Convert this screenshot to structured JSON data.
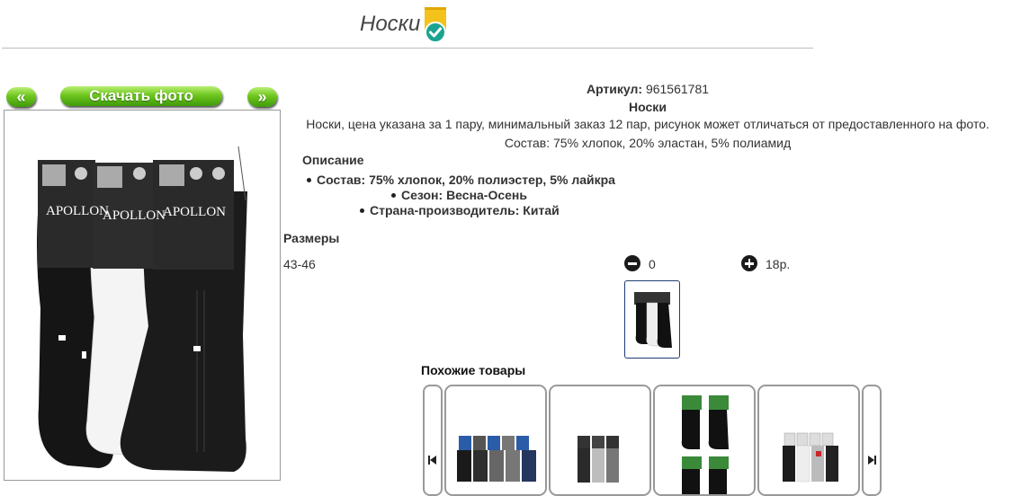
{
  "header": {
    "title": "Носки"
  },
  "photo_controls": {
    "prev_label": "«",
    "download_label": "Скачать фото",
    "next_label": "»"
  },
  "product": {
    "article_label": "Артикул:",
    "article_value": "961561781",
    "name": "Носки",
    "summary": "Носки, цена указана за 1 пару, минимальный заказ 12 пар, рисунок может отличаться от предоставленного на фото.",
    "composition": "Состав: 75% хлопок, 20% эластан, 5% полиамид",
    "description_heading": "Описание",
    "specs": [
      "Состав: 75% хлопок, 20% полиэстер, 5% лайкра",
      "Сезон: Весна-Осень",
      "Страна-производитель: Китай"
    ],
    "brand_label": "APOLLON"
  },
  "sizes": {
    "heading": "Размеры",
    "rows": [
      {
        "size": "43-46",
        "quantity": "0",
        "price": "18р."
      }
    ]
  },
  "similar": {
    "heading": "Похожие товары"
  },
  "colors": {
    "accent_green": "#6ec61e",
    "badge_yellow": "#f3c21b",
    "badge_teal": "#1aa391",
    "border_gray": "#999999"
  },
  "icons": {
    "verified": "verified-check-icon",
    "minus": "minus-circle-icon",
    "plus": "plus-circle-icon",
    "prev": "skip-back-icon",
    "next": "skip-forward-icon"
  }
}
